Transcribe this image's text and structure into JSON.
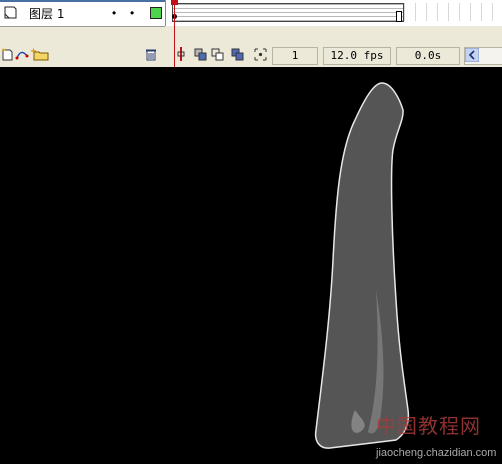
{
  "layer": {
    "name": "图层 1",
    "eye_symbol": "•",
    "lock_symbol": "•",
    "outline_color": "#4cd44c"
  },
  "timeline": {
    "current_frame": "1",
    "frame_rate": "12.0 fps",
    "elapsed_time": "0.0s",
    "playhead_color": "#c0101a"
  },
  "icons": {
    "layer": "layer-page-icon",
    "add_layer": "add-layer-icon",
    "add_guide": "add-motion-guide-icon",
    "add_folder": "add-folder-icon",
    "delete": "trash-icon",
    "center_frame": "center-frame-icon",
    "onion_skin": "onion-skin-icon",
    "onion_outline": "onion-skin-outlines-icon",
    "edit_multiple": "edit-multiple-frames-icon",
    "modify_markers": "modify-onion-markers-icon",
    "scroll_left": "scroll-left-icon"
  },
  "stage": {
    "background": "#000000",
    "shape_fill": "#555555",
    "shape_stroke": "#e8e8e8"
  },
  "watermark": {
    "title": "中国教程网",
    "url": "jiaocheng.chazidian.com"
  }
}
